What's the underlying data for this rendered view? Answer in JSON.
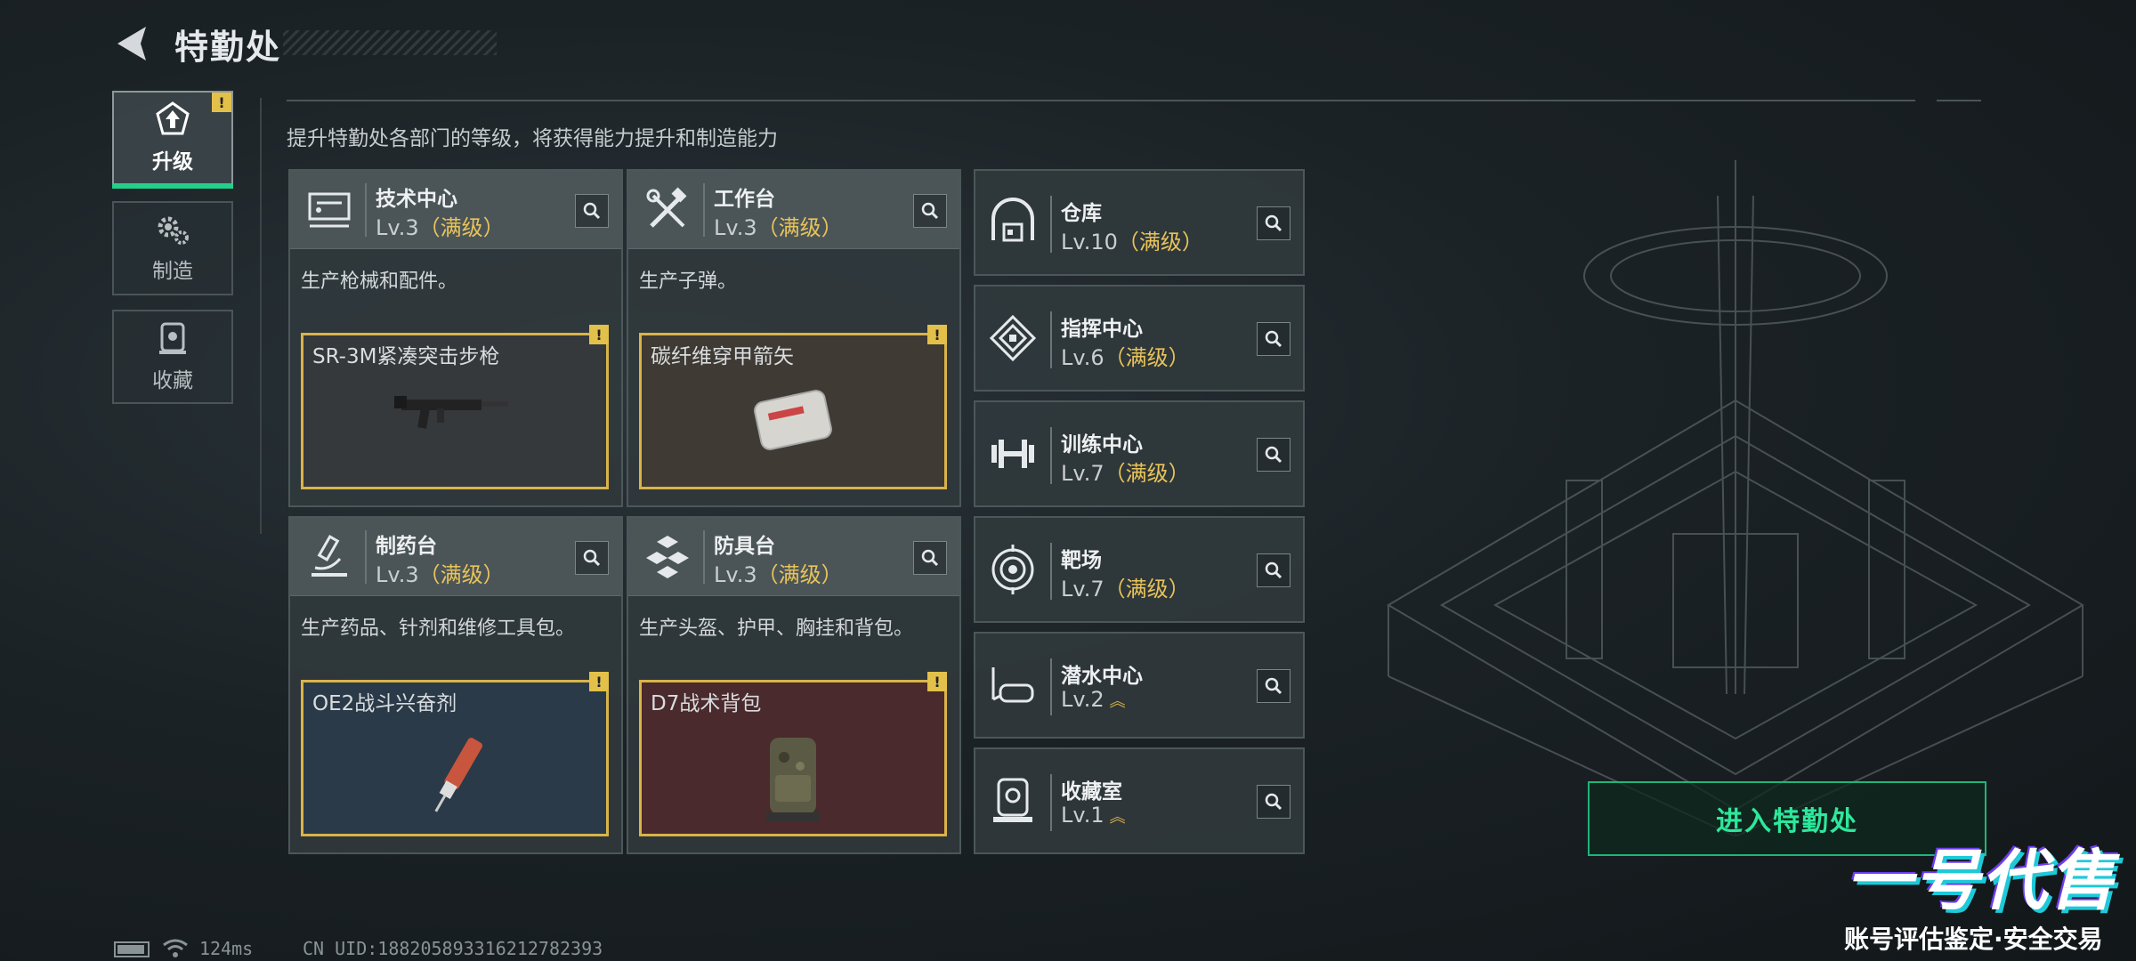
{
  "header": {
    "title": "特勤处"
  },
  "tabs": [
    {
      "label": "升级",
      "active": true,
      "alert": "!"
    },
    {
      "label": "制造",
      "active": false
    },
    {
      "label": "收藏",
      "active": false
    }
  ],
  "subtitle": "提升特勤处各部门的等级，将获得能力提升和制造能力",
  "cards": [
    {
      "name": "技术中心",
      "level": "Lv.3",
      "status": "（满级）",
      "desc": "生产枪械和配件。",
      "product": "SR-3M紧凑突击步枪",
      "alert": "!",
      "product_bg": "#35393c",
      "icon": "tech-center-icon"
    },
    {
      "name": "工作台",
      "level": "Lv.3",
      "status": "（满级）",
      "desc": "生产子弹。",
      "product": "碳纤维穿甲箭矢",
      "alert": "!",
      "product_bg": "#3f3a33",
      "icon": "workbench-icon"
    },
    {
      "name": "制药台",
      "level": "Lv.3",
      "status": "（满级）",
      "desc": "生产药品、针剂和维修工具包。",
      "product": "OE2战斗兴奋剂",
      "alert": "!",
      "product_bg": "#2a3a48",
      "icon": "pharmacy-icon"
    },
    {
      "name": "防具台",
      "level": "Lv.3",
      "status": "（满级）",
      "desc": "生产头盔、护甲、胸挂和背包。",
      "product": "D7战术背包",
      "alert": "!",
      "product_bg": "#4a2a2c",
      "icon": "armor-bench-icon"
    }
  ],
  "rows": [
    {
      "name": "仓库",
      "level": "Lv.10",
      "status": "（满级）",
      "icon": "warehouse-icon"
    },
    {
      "name": "指挥中心",
      "level": "Lv.6",
      "status": "（满级）",
      "icon": "command-center-icon"
    },
    {
      "name": "训练中心",
      "level": "Lv.7",
      "status": "（满级）",
      "icon": "training-center-icon"
    },
    {
      "name": "靶场",
      "level": "Lv.7",
      "status": "（满级）",
      "icon": "shooting-range-icon"
    },
    {
      "name": "潜水中心",
      "level": "Lv.2",
      "status": "",
      "icon": "diving-center-icon"
    },
    {
      "name": "收藏室",
      "level": "Lv.1",
      "status": "",
      "icon": "collection-room-icon"
    }
  ],
  "enter_button": "进入特勤处",
  "status_bar": {
    "ping": "124ms",
    "uid": "CN UID:18820589331621278239​3"
  },
  "watermark": {
    "logo": "一号代售",
    "tagline": "账号评估鉴定·安全交易"
  },
  "colors": {
    "accent_green": "#1fd28a",
    "maxed_gold": "#e8c35a",
    "alert_yellow": "#e2c04a"
  }
}
